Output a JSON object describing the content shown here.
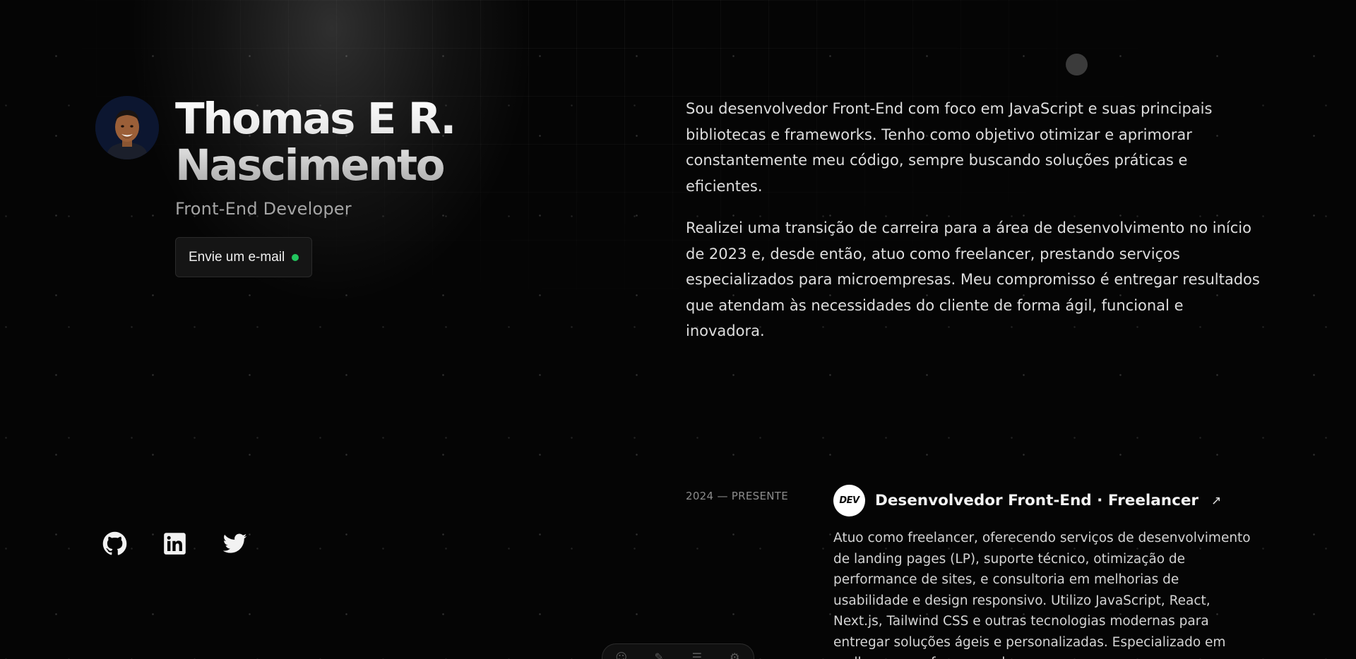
{
  "profile": {
    "name": "Thomas E R. Nascimento",
    "role": "Front-End Developer",
    "email_button": "Envie um e-mail",
    "status_color": "#22c55e"
  },
  "about": {
    "paragraphs": [
      "Sou desenvolvedor Front-End com foco em JavaScript e suas principais bibliotecas e frameworks. Tenho como objetivo otimizar e aprimorar constantemente meu código, sempre buscando soluções práticas e eficientes.",
      "Realizei uma transição de carreira para a área de desenvolvimento no início de 2023 e, desde então, atuo como freelancer, prestando serviços especializados para microempresas. Meu compromisso é entregar resultados que atendam às necessidades do cliente de forma ágil, funcional e inovadora."
    ]
  },
  "experience": [
    {
      "period": "2024 — PRESENTE",
      "logo_text": "DEV",
      "title": "Desenvolvedor Front-End · Freelancer",
      "description": "Atuo como freelancer, oferecendo serviços de desenvolvimento de landing pages (LP), suporte técnico, otimização de performance de sites, e consultoria em melhorias de usabilidade e design responsivo. Utilizo JavaScript, React, Next.js, Tailwind CSS e outras tecnologias modernas para entregar soluções ágeis e personalizadas. Especializado em melhorar a performance de"
    }
  ],
  "socials": [
    {
      "name": "github",
      "icon": "github-icon"
    },
    {
      "name": "linkedin",
      "icon": "linkedin-icon"
    },
    {
      "name": "twitter",
      "icon": "twitter-icon"
    }
  ],
  "dock": {
    "icons": [
      "user-icon",
      "tag-icon",
      "menu-icon",
      "settings-icon"
    ]
  }
}
